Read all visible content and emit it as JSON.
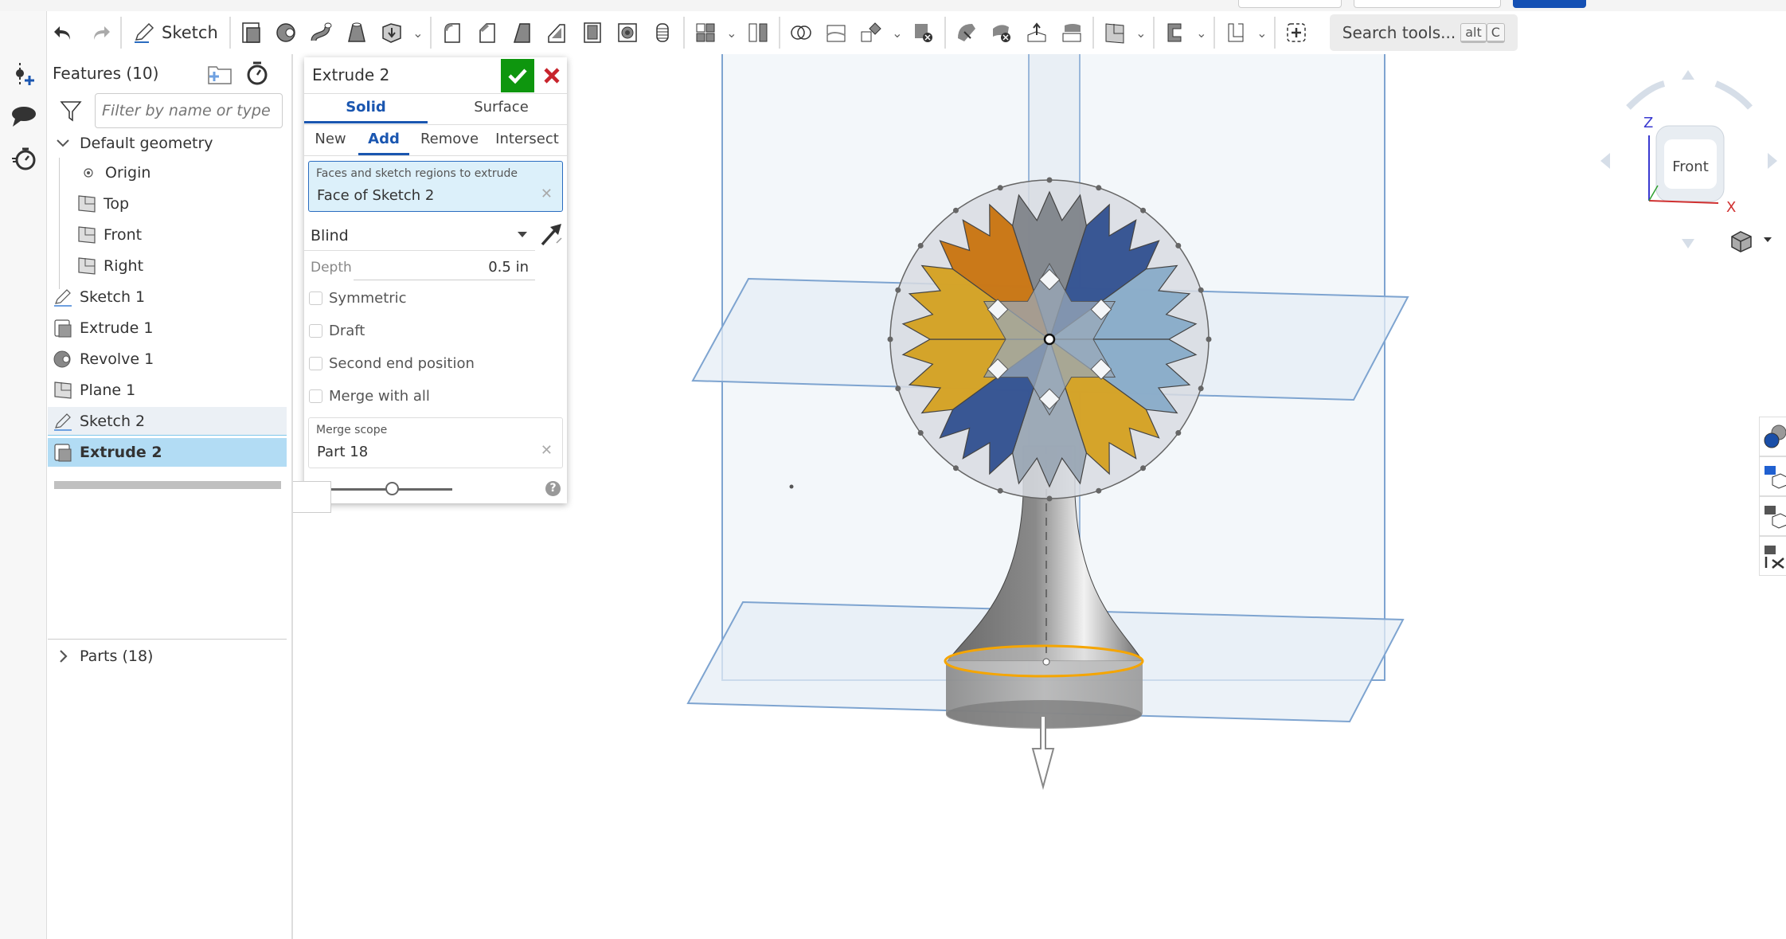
{
  "toolbar": {
    "undo": "undo-icon",
    "redo": "redo-icon",
    "sketch_label": "Sketch",
    "search_label": "Search tools...",
    "search_key1": "alt",
    "search_key2": "C"
  },
  "features": {
    "title": "Features (10)",
    "filter_placeholder": "Filter by name or type",
    "default_geometry": "Default geometry",
    "items": [
      {
        "label": "Origin",
        "icon": "origin-icon"
      },
      {
        "label": "Top",
        "icon": "plane-icon"
      },
      {
        "label": "Front",
        "icon": "plane-icon"
      },
      {
        "label": "Right",
        "icon": "plane-icon"
      },
      {
        "label": "Sketch 1",
        "icon": "sketch-icon"
      },
      {
        "label": "Extrude 1",
        "icon": "extrude-icon"
      },
      {
        "label": "Revolve 1",
        "icon": "revolve-icon"
      },
      {
        "label": "Plane 1",
        "icon": "plane-icon"
      },
      {
        "label": "Sketch 2",
        "icon": "sketch-icon"
      },
      {
        "label": "Extrude 2",
        "icon": "extrude-icon"
      }
    ],
    "parts_label": "Parts (18)"
  },
  "dialog": {
    "title": "Extrude 2",
    "tabs": [
      "Solid",
      "Surface"
    ],
    "active_tab": "Solid",
    "ops": [
      "New",
      "Add",
      "Remove",
      "Intersect"
    ],
    "active_op": "Add",
    "query_label": "Faces and sketch regions to extrude",
    "query_value": "Face of Sketch 2",
    "end_type": "Blind",
    "depth_label": "Depth",
    "depth_value": "0.5 in",
    "checkboxes": [
      {
        "label": "Symmetric",
        "checked": false
      },
      {
        "label": "Draft",
        "checked": false
      },
      {
        "label": "Second end position",
        "checked": false
      },
      {
        "label": "Merge with all",
        "checked": false
      }
    ],
    "merge_scope_label": "Merge scope",
    "merge_scope_value": "Part 18",
    "slider_value": 0.55,
    "help": "?"
  },
  "viewcube": {
    "face_label": "Front",
    "axis_z": "Z",
    "axis_x": "X"
  },
  "colors": {
    "accent": "#1a56b0",
    "ok": "#0e960e",
    "cancel": "#c8232c",
    "selected_row": "#b2dcf4",
    "orange": "#c8730e",
    "gold": "#d4a020",
    "blue": "#2f4f8f",
    "lightblue": "#88abc8",
    "selection_edge": "#f5a500"
  }
}
